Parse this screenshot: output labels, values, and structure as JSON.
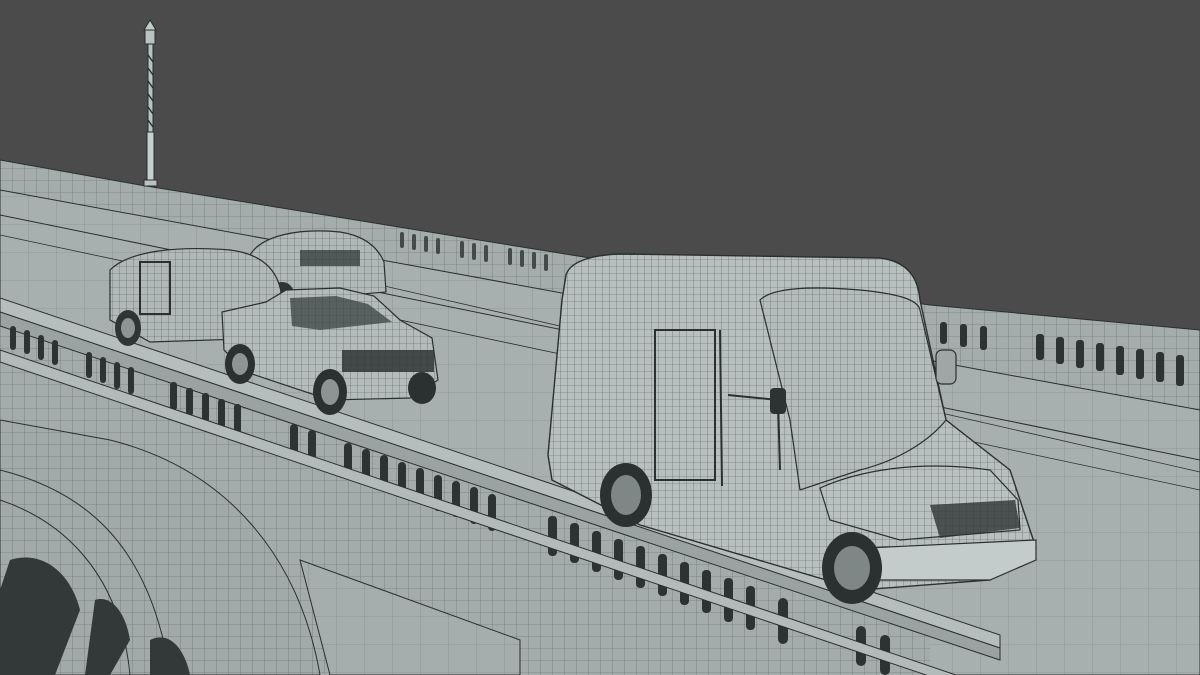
{
  "scene": {
    "background_color": "#4b4b4b",
    "surface_color": "#aab3b2",
    "wire_color": "#2a2f2f",
    "deck_color": "#a7b0af",
    "shadow_color": "#8e9796",
    "objects": [
      {
        "name": "lamp-post",
        "kind": "street-lamp"
      },
      {
        "name": "bridge-far-parapet",
        "kind": "balustrade"
      },
      {
        "name": "bridge-deck",
        "kind": "roadway"
      },
      {
        "name": "bridge-near-parapet",
        "kind": "balustrade"
      },
      {
        "name": "bridge-arches",
        "kind": "stone-arches"
      },
      {
        "name": "car-roof-tent",
        "kind": "suv-with-roof-tent"
      },
      {
        "name": "teardrop-trailer",
        "kind": "camper-trailer"
      },
      {
        "name": "pickup-truck",
        "kind": "pickup"
      },
      {
        "name": "delivery-van",
        "kind": "step-van"
      }
    ]
  }
}
